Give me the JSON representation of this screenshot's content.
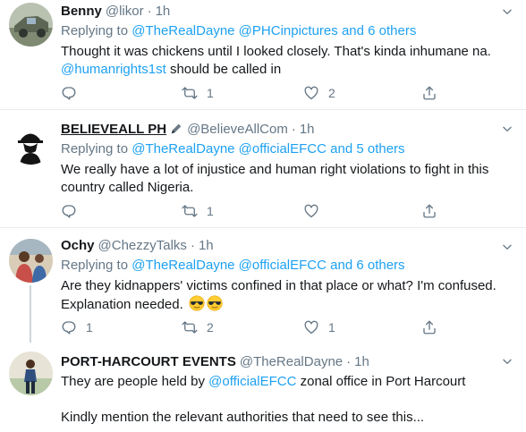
{
  "tweets": [
    {
      "name": "Benny",
      "handle": "@likor",
      "dot": "·",
      "time": "1h",
      "replying_prefix": "Replying to",
      "replying_users": "@TheRealDayne @PHCinpictures",
      "replying_suffix": "and 6 others",
      "line1": "Thought it was chickens until I looked closely. That's kinda inhumane na.",
      "line2_link": "@humanrights1st",
      "line2_text": " should be called in",
      "reply_count": "",
      "retweet_count": "1",
      "like_count": "2"
    },
    {
      "name": "BELIEVEALL PH",
      "handle": "@BelieveAllCom",
      "dot": "·",
      "time": "1h",
      "replying_prefix": "Replying to",
      "replying_users": "@TheRealDayne @officialEFCC",
      "replying_suffix": "and 5 others",
      "line1": "We really have a lot of injustice and human right violations to fight in this",
      "line2_text": "country called Nigeria.",
      "reply_count": "",
      "retweet_count": "1",
      "like_count": ""
    },
    {
      "name": "Ochy",
      "handle": "@ChezzyTalks",
      "dot": "·",
      "time": "1h",
      "replying_prefix": "Replying to",
      "replying_users": "@TheRealDayne @officialEFCC",
      "replying_suffix": "and 6 others",
      "line1": "Are they kidnappers' victims confined in that place or what? I'm confused.",
      "line2_text": "Explanation needed.",
      "reply_count": "1",
      "retweet_count": "2",
      "like_count": "1"
    },
    {
      "name": "PORT-HARCOURT EVENTS",
      "handle": "@TheRealDayne",
      "dot": "·",
      "time": "1h",
      "line1_pre": "They are people held by ",
      "line1_link": "@officialEFCC",
      "line1_post": " zonal office in Port Harcourt",
      "line3": "Kindly mention the relevant authorities that need to see this..."
    }
  ],
  "icons": {
    "reply": "reply-icon",
    "retweet": "retweet-icon",
    "like": "heart-icon",
    "share": "share-icon",
    "caret": "chevron-down-icon",
    "pen": "pen-icon",
    "emoji": "sunglasses-emoji"
  },
  "colors": {
    "link": "#1da1f2",
    "secondary_text": "#657786",
    "divider": "#e6ecf0"
  }
}
